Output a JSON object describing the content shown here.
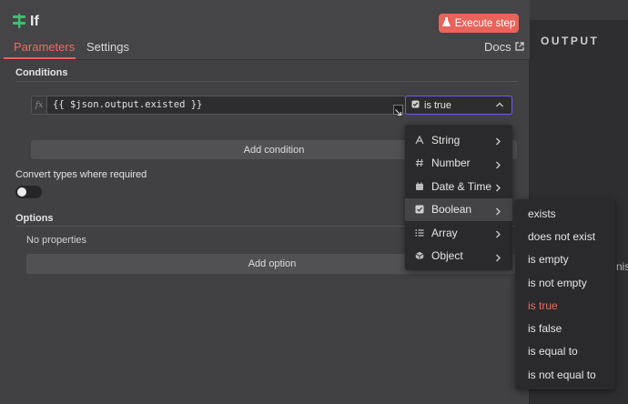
{
  "node": {
    "title": "If",
    "execute_label": "Execute step"
  },
  "tabs": [
    {
      "label": "Parameters",
      "active": true
    },
    {
      "label": "Settings",
      "active": false
    }
  ],
  "docs_label": "Docs",
  "output_label": "OUTPUT",
  "right_partial_text": "nis",
  "conditions": {
    "section_label": "Conditions",
    "expression": "{{ $json.output.existed }}",
    "operator_selected": "is true",
    "add_label": "Add condition"
  },
  "convert_types": {
    "label": "Convert types where required",
    "enabled": false
  },
  "options": {
    "section_label": "Options",
    "empty_text": "No properties",
    "add_label": "Add option"
  },
  "type_menu": [
    {
      "label": "String",
      "icon": "text-type-icon"
    },
    {
      "label": "Number",
      "icon": "hash-icon"
    },
    {
      "label": "Date & Time",
      "icon": "calendar-icon"
    },
    {
      "label": "Boolean",
      "icon": "checkbox-icon",
      "active": true
    },
    {
      "label": "Array",
      "icon": "list-icon"
    },
    {
      "label": "Object",
      "icon": "cube-icon"
    }
  ],
  "boolean_operators": [
    {
      "label": "exists"
    },
    {
      "label": "does not exist"
    },
    {
      "label": "is empty"
    },
    {
      "label": "is not empty"
    },
    {
      "label": "is true",
      "selected": true
    },
    {
      "label": "is false"
    },
    {
      "label": "is equal to"
    },
    {
      "label": "is not equal to"
    }
  ],
  "colors": {
    "accent": "#e9635a",
    "focus_border": "#6d5cf0",
    "node_icon": "#3fbf6f"
  }
}
